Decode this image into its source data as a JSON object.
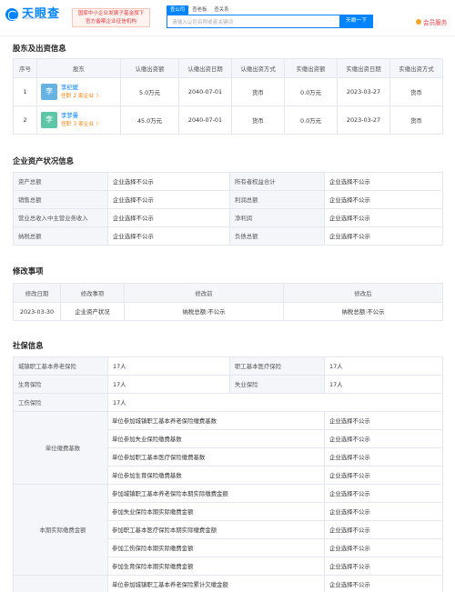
{
  "header": {
    "logo_text": "天眼查",
    "logo_sub": "TianYanCha.com",
    "badge_line1": "国家中小企业发展子基金旗下",
    "badge_line2": "官方备案企业征信机构",
    "tabs": [
      "查公司",
      "查老板",
      "查关系"
    ],
    "search_placeholder": "请输入公司名称或者关键词",
    "search_button": "天眼一下",
    "vip_label": "会员服务"
  },
  "shareholders": {
    "title": "股东及出资信息",
    "columns": [
      "序号",
      "股东",
      "认缴出资额",
      "认缴出资日期",
      "认缴出资方式",
      "实缴出资额",
      "实缴出资日期",
      "实缴出资方式"
    ],
    "rows": [
      {
        "no": "1",
        "avatar": "李",
        "avatar_color": "#66b3e3",
        "name": "李纪媛",
        "sub": "任职 2 家企业 〉",
        "subscribed": "5.0万元",
        "sub_date": "2040-07-01",
        "sub_method": "货币",
        "paid": "0.0万元",
        "paid_date": "2023-03-27",
        "paid_method": "货币"
      },
      {
        "no": "2",
        "avatar": "李",
        "avatar_color": "#5cc6a7",
        "name": "李梦曼",
        "sub": "任职 3 家企业 〉",
        "subscribed": "45.0万元",
        "sub_date": "2040-07-01",
        "sub_method": "货币",
        "paid": "0.0万元",
        "paid_date": "2023-03-27",
        "paid_method": "货币"
      }
    ]
  },
  "assets": {
    "title": "企业资产状况信息",
    "rows": [
      [
        "资产总额",
        "企业选择不公示",
        "所有者权益合计",
        "企业选择不公示"
      ],
      [
        "销售总额",
        "企业选择不公示",
        "利润总额",
        "企业选择不公示"
      ],
      [
        "营业总收入中主营业务收入",
        "企业选择不公示",
        "净利润",
        "企业选择不公示"
      ],
      [
        "纳税总额",
        "企业选择不公示",
        "负债总额",
        "企业选择不公示"
      ]
    ]
  },
  "changes": {
    "title": "修改事项",
    "columns": [
      "修改日期",
      "修改事项",
      "修改前",
      "修改后"
    ],
    "rows": [
      [
        "2023-03-30",
        "企业资产状况",
        "纳税总额:不公示",
        "纳税总额:不公示"
      ]
    ]
  },
  "social": {
    "title": "社保信息",
    "rows_simple": [
      [
        "城镇职工基本养老保险",
        "17人",
        "职工基本医疗保险",
        "17人"
      ],
      [
        "生育保险",
        "17人",
        "失业保险",
        "17人"
      ]
    ],
    "injury": [
      "工伤保险",
      "17人"
    ],
    "unit_base_label": "单位缴费基数",
    "unit_base": [
      [
        "单位参加城镇职工基本养老保险缴费基数",
        "企业选择不公示"
      ],
      [
        "单位参加失业保险缴费基数",
        "企业选择不公示"
      ],
      [
        "单位参加职工基本医疗保险缴费基数",
        "企业选择不公示"
      ],
      [
        "单位参加生育保险缴费基数",
        "企业选择不公示"
      ]
    ],
    "actual_label": "本期实际缴费金额",
    "actual": [
      [
        "参加城镇职工基本养老保险本期实际缴费金额",
        "企业选择不公示"
      ],
      [
        "参加失业保险本期实际缴费金额",
        "企业选择不公示"
      ],
      [
        "参加职工基本医疗保险本期实际缴费金额",
        "企业选择不公示"
      ],
      [
        "参加工伤保险本期实际缴费金额",
        "企业选择不公示"
      ],
      [
        "参加生育保险本期实际缴费金额",
        "企业选择不公示"
      ]
    ],
    "arrears": [
      [
        "单位参加城镇职工基本养老保险累计欠缴金额",
        "企业选择不公示"
      ]
    ]
  }
}
